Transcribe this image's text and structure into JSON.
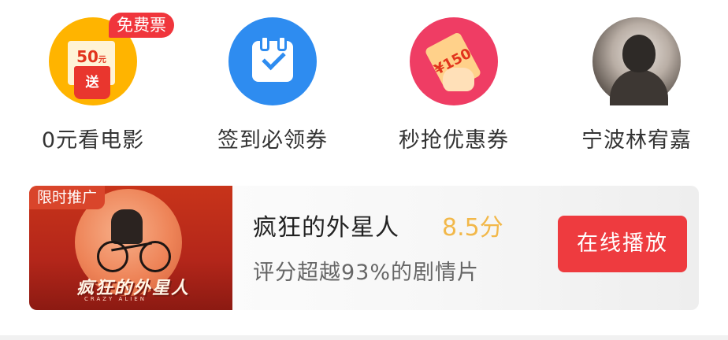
{
  "entries": [
    {
      "label": "0元看电影",
      "icon": "ticket-icon",
      "badge": "免费票",
      "ticket_value": "50",
      "ticket_unit": "元",
      "envelope_text": "送",
      "color": "#ffb400"
    },
    {
      "label": "签到必领券",
      "icon": "calendar-check-icon",
      "color": "#2e8cf0"
    },
    {
      "label": "秒抢优惠券",
      "icon": "coupon-icon",
      "coupon_text": "¥150",
      "color": "#ef3d64"
    },
    {
      "label": "宁波林宥嘉",
      "icon": "avatar"
    }
  ],
  "promo": {
    "tag": "限时推广",
    "poster_title": "疯狂的外星人",
    "poster_subtitle": "CRAZY ALIEN",
    "title": "疯狂的外星人",
    "score": "8.5分",
    "description": "评分超越93%的剧情片",
    "button_label": "在线播放",
    "accent_color": "#ee3b3f",
    "score_color": "#f2b84a"
  }
}
